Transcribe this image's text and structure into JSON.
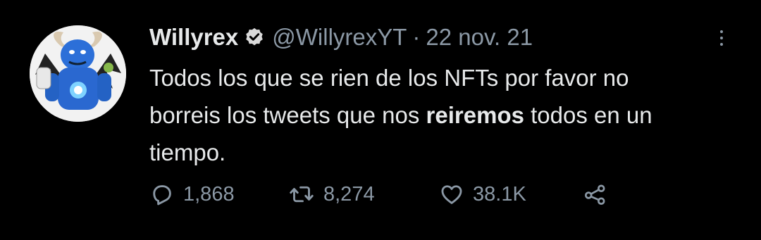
{
  "tweet": {
    "author_name": "Willyrex",
    "handle": "@WillyrexYT",
    "separator": "·",
    "date": "22 nov. 21",
    "text_before": "Todos los que se rien de los NFTs por favor no borreis los tweets que nos ",
    "text_bold": "reiremos",
    "text_after": " todos en un tiempo."
  },
  "actions": {
    "replies": "1,868",
    "retweets": "8,274",
    "likes": "38.1K"
  },
  "icons": {
    "verified": "verified-badge-icon",
    "more": "more-options-icon",
    "reply": "reply-icon",
    "retweet": "retweet-icon",
    "like": "heart-icon",
    "share": "share-icon"
  },
  "colors": {
    "background": "#000000",
    "text": "#e7e9ea",
    "muted": "#8b98a5"
  }
}
